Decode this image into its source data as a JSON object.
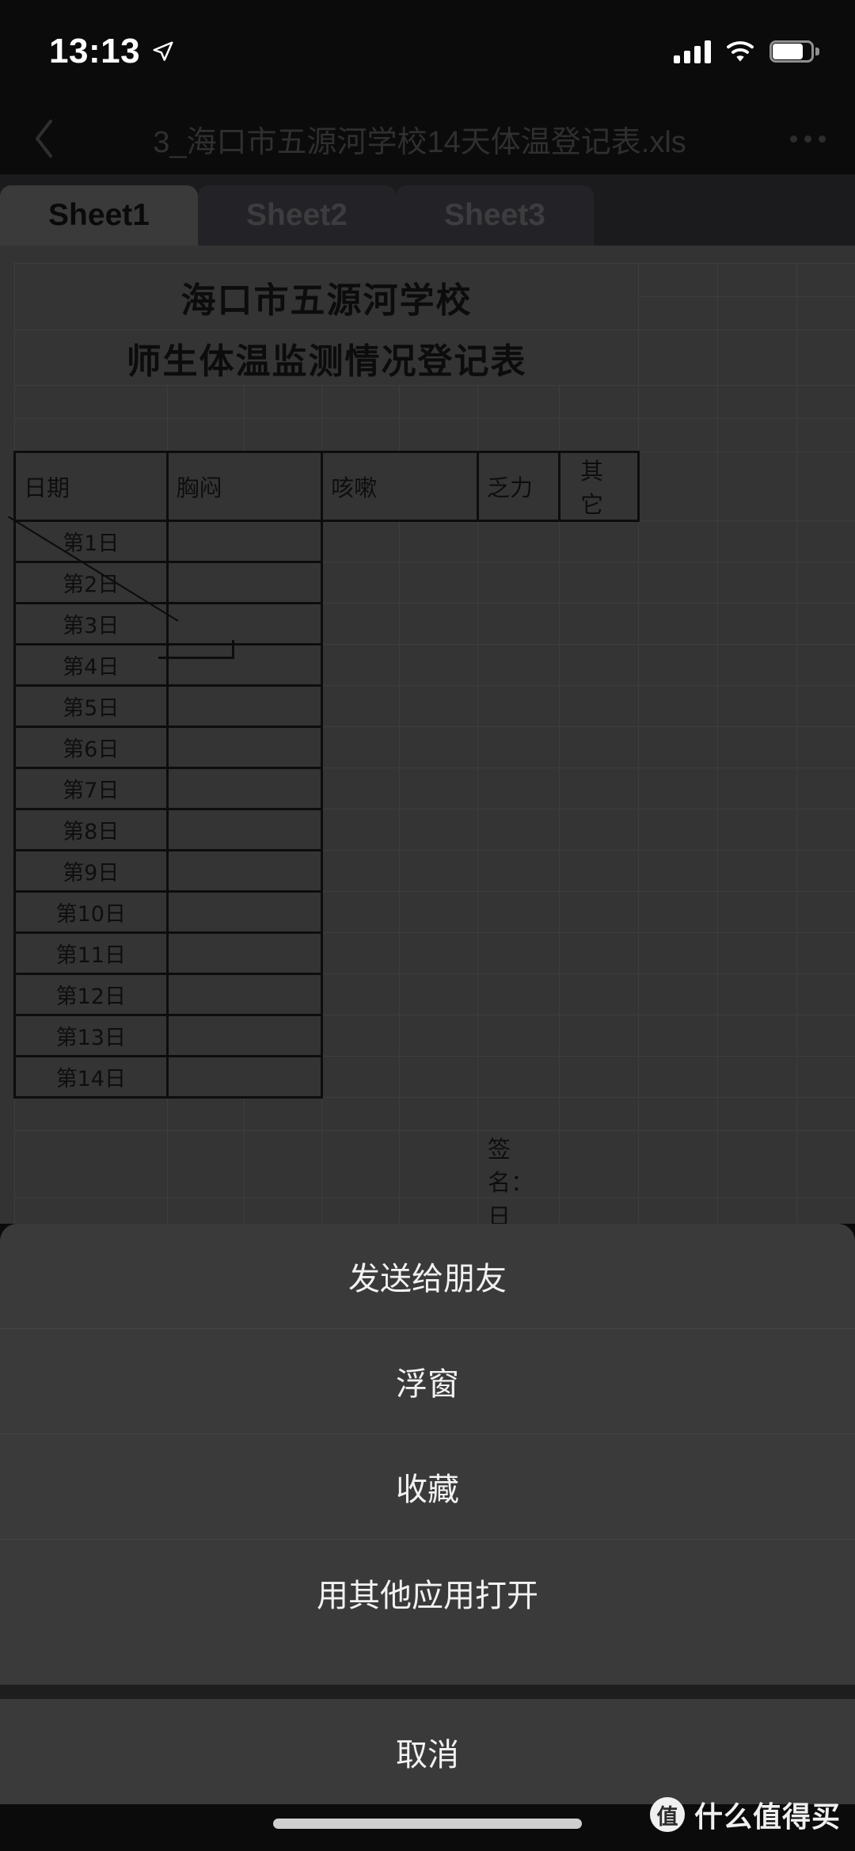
{
  "status_bar": {
    "time": "13:13",
    "location_icon": "location-arrow-icon",
    "signal_icon": "cellular-signal-icon",
    "wifi_icon": "wifi-icon",
    "battery_icon": "battery-icon"
  },
  "nav_bar": {
    "back_icon": "chevron-left-icon",
    "title": "3_海口市五源河学校14天体温登记表.xls",
    "more_icon": "more-options-icon"
  },
  "sheet_tabs": [
    {
      "label": "Sheet1",
      "active": true
    },
    {
      "label": "Sheet2",
      "active": false
    },
    {
      "label": "Sheet3",
      "active": false
    }
  ],
  "spreadsheet": {
    "title_line1": "海口市五源河学校",
    "title_line2": "师生体温监测情况登记表",
    "headers": [
      "日期",
      "胸闷",
      "咳嗽",
      "乏力",
      "其  它"
    ],
    "rows": [
      "第1日",
      "第2日",
      "第3日",
      "第4日",
      "第5日",
      "第6日",
      "第7日",
      "第8日",
      "第9日",
      "第10日",
      "第11日",
      "第12日",
      "第13日",
      "第14日"
    ],
    "signature_label": "签名：",
    "date_label": "日期："
  },
  "action_sheet": {
    "items": [
      "发送给朋友",
      "浮窗",
      "收藏",
      "用其他应用打开"
    ],
    "cancel": "取消"
  },
  "watermark": {
    "logo_char": "值",
    "text": "什么值得买"
  },
  "colors": {
    "page_bg": "#0b0b0b",
    "doc_dim": "#333333",
    "menu_bg": "#3a3a3a",
    "tab_active_bg": "#3a3a3a",
    "tab_inactive_bg": "#232327"
  }
}
